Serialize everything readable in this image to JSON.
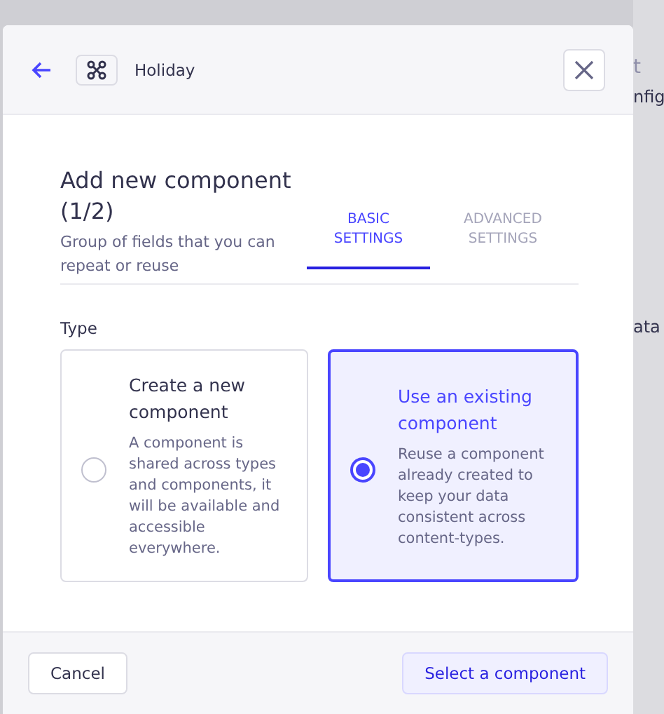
{
  "background": {
    "texts": [
      "t",
      "nfig",
      "ata"
    ]
  },
  "header": {
    "title": "Holiday"
  },
  "heading": "Add new component (1/2)",
  "description": "Group of fields that you can repeat or reuse",
  "tabs": [
    {
      "label": "BASIC SETTINGS",
      "selected": true
    },
    {
      "label": "ADVANCED SETTINGS",
      "selected": false
    }
  ],
  "type_label": "Type",
  "options": [
    {
      "title": "Create a new component",
      "description": "A component is shared across types and components, it will be available and accessible everywhere.",
      "selected": false
    },
    {
      "title": "Use an existing component",
      "description": "Reuse a component already created to keep your data consistent across content-types.",
      "selected": true
    }
  ],
  "footer": {
    "cancel": "Cancel",
    "confirm": "Select a component"
  }
}
